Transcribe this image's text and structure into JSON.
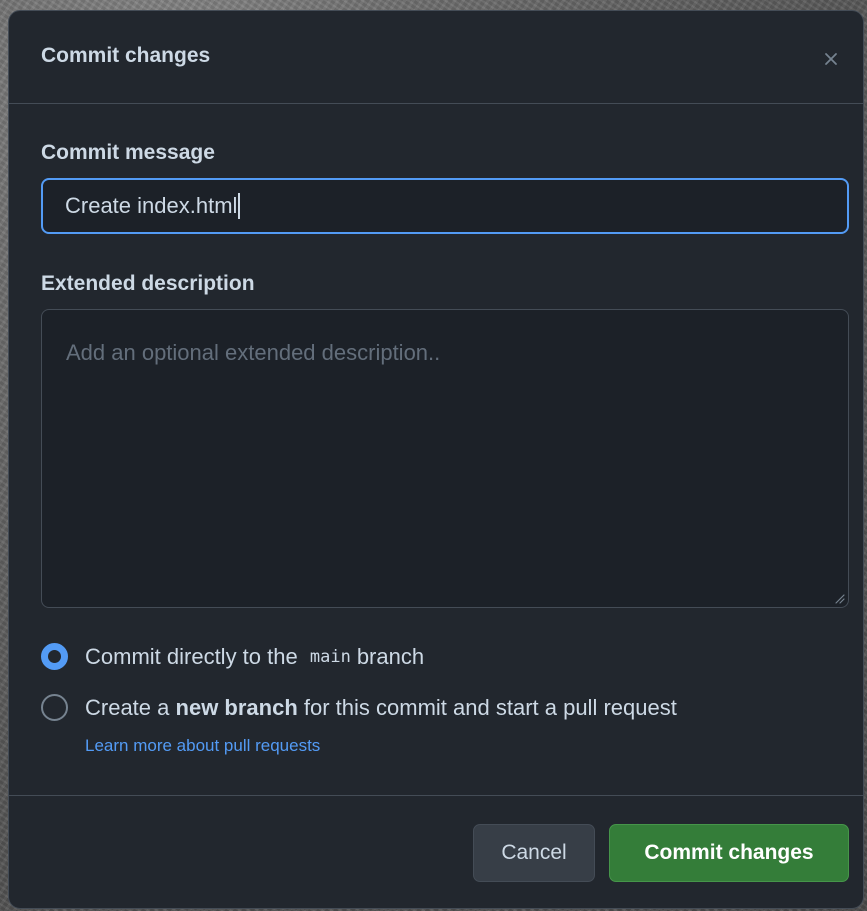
{
  "dialog": {
    "title": "Commit changes",
    "close_icon": "close-icon"
  },
  "commit_message": {
    "label": "Commit message",
    "value": "Create index.html"
  },
  "extended_description": {
    "label": "Extended description",
    "placeholder": "Add an optional extended description.."
  },
  "branch_options": {
    "direct": {
      "prefix": "Commit directly to the",
      "branch": "main",
      "suffix": "branch",
      "selected": true
    },
    "new_branch": {
      "prefix": "Create a",
      "bold": "new branch",
      "suffix": "for this commit and start a pull request",
      "selected": false
    },
    "learn_more": "Learn more about pull requests"
  },
  "footer": {
    "cancel_label": "Cancel",
    "commit_label": "Commit changes"
  },
  "colors": {
    "background": "#22272e",
    "accent": "#539bf5",
    "primary_button": "#347d39"
  }
}
